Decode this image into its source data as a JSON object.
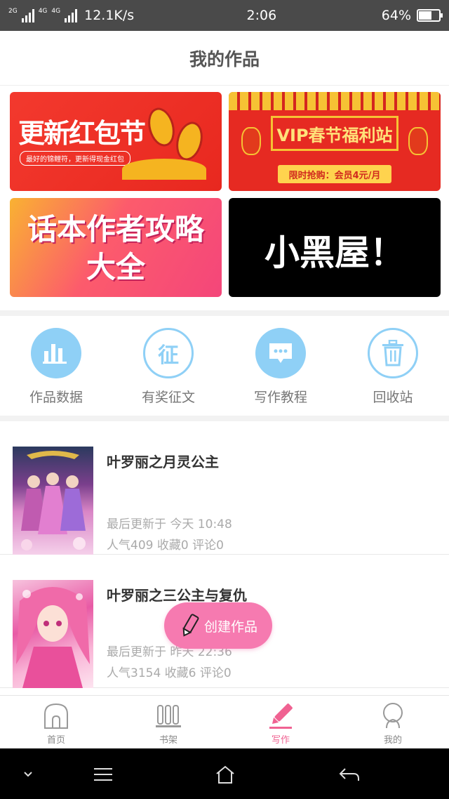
{
  "status_bar": {
    "network_1": "2G",
    "network_2": "4G",
    "network_3": "4G",
    "speed": "12.1K/s",
    "time": "2:06",
    "battery_text": "64%",
    "battery_level": 0.64
  },
  "header": {
    "title": "我的作品"
  },
  "banners": [
    {
      "title": "更新红包节",
      "subtitle": "最好的锦鲤符，更新得现金红包"
    },
    {
      "title": "VIP春节福利站",
      "subtitle": "限时抢购：会员4元/月"
    },
    {
      "title_line1": "话本作者攻略",
      "title_line2": "大全"
    },
    {
      "title": "小黑屋！"
    }
  ],
  "shortcuts": [
    {
      "label": "作品数据",
      "icon": "bar-chart-icon"
    },
    {
      "label": "有奖征文",
      "icon": "contest-icon",
      "glyph": "征"
    },
    {
      "label": "写作教程",
      "icon": "chat-bubble-icon"
    },
    {
      "label": "回收站",
      "icon": "trash-icon"
    }
  ],
  "works": [
    {
      "title": "叶罗丽之月灵公主",
      "updated": "最后更新于 今天 10:48",
      "stats": "人气409  收藏0  评论0"
    },
    {
      "title": "叶罗丽之三公主与复仇",
      "updated": "最后更新于 昨天 22:36",
      "stats": "人气3154  收藏6  评论0"
    }
  ],
  "fab": {
    "label": "创建作品"
  },
  "tabs": [
    {
      "label": "首页",
      "icon": "home-icon"
    },
    {
      "label": "书架",
      "icon": "bookshelf-icon"
    },
    {
      "label": "写作",
      "icon": "pencil-icon",
      "active": true
    },
    {
      "label": "我的",
      "icon": "profile-icon"
    }
  ],
  "colors": {
    "accent": "#f06292",
    "icon_blue": "#8fd0f6",
    "fab_pink": "#f67ab0"
  }
}
